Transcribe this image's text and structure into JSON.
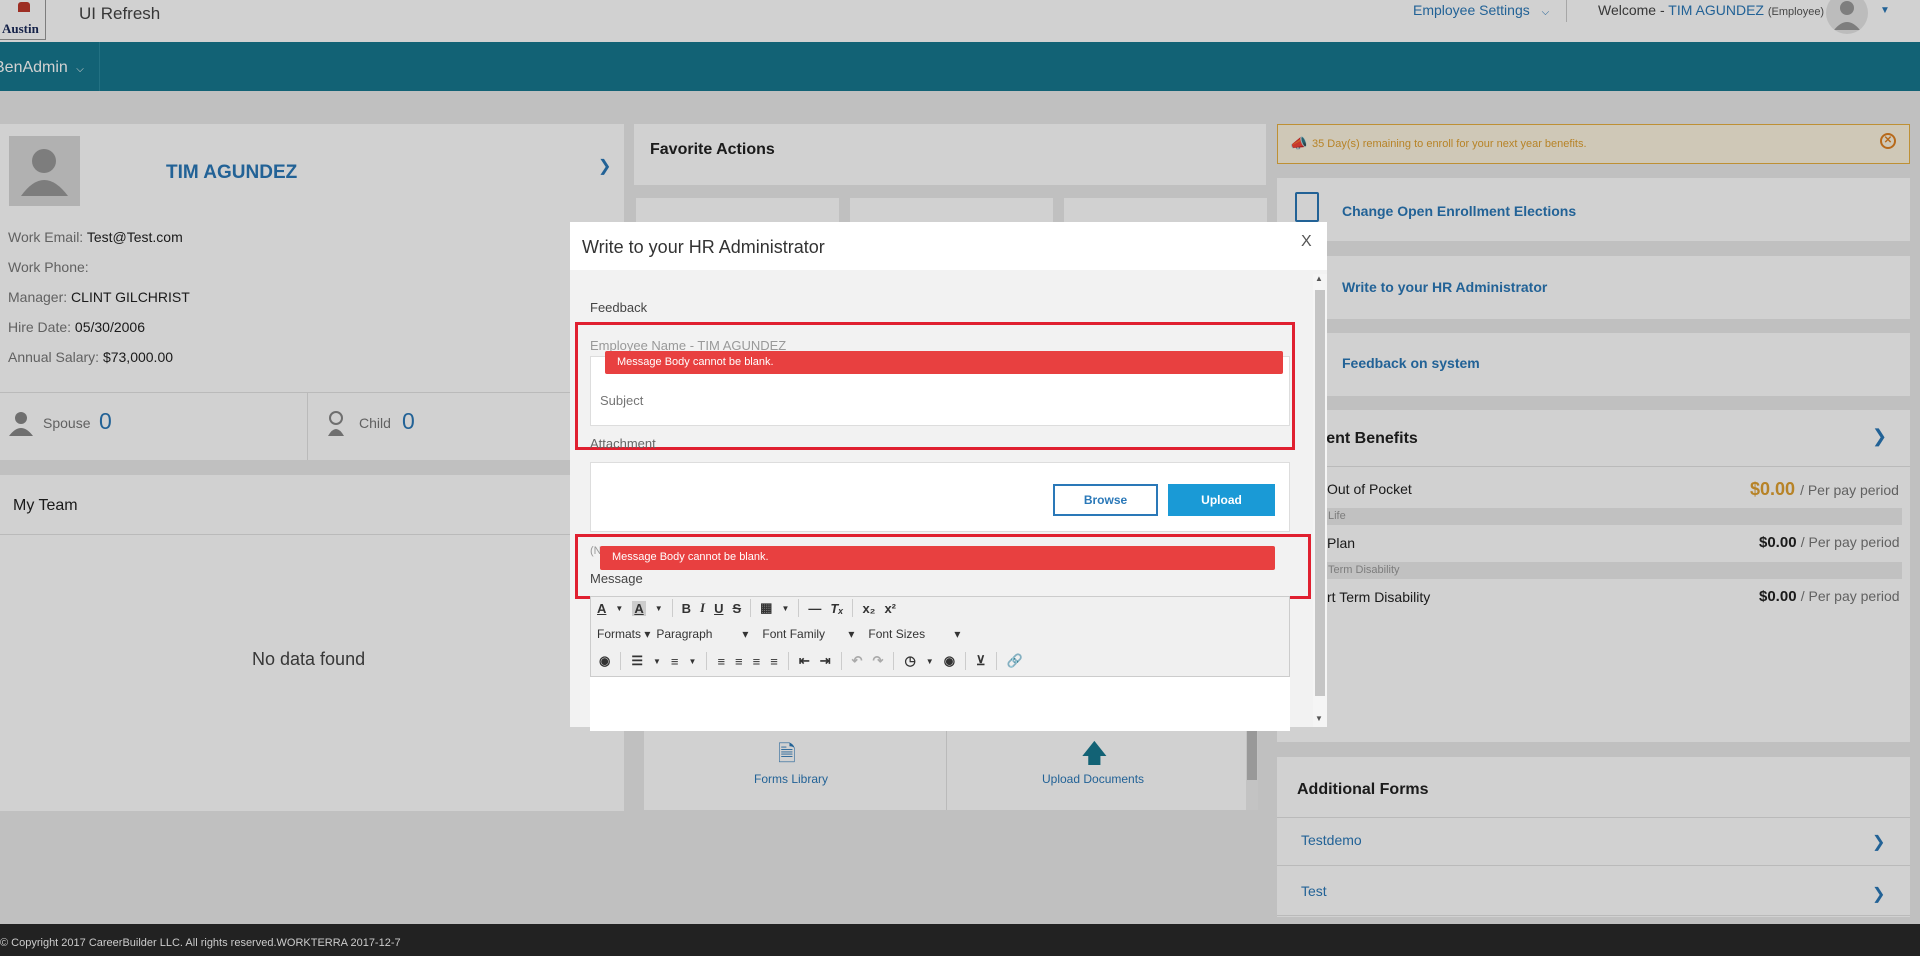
{
  "header": {
    "logo_text": "Austin",
    "app_title": "UI Refresh",
    "employee_settings": "Employee Settings",
    "welcome_prefix": "Welcome -",
    "user_name": "TIM AGUNDEZ",
    "user_role": "(Employee)",
    "nav_item": "BenAdmin"
  },
  "profile": {
    "name": "TIM AGUNDEZ",
    "fields": [
      {
        "label": "Work Email:",
        "value": "Test@Test.com"
      },
      {
        "label": "Work Phone:",
        "value": ""
      },
      {
        "label": "Manager:",
        "value": "CLINT GILCHRIST"
      },
      {
        "label": "Hire Date:",
        "value": "05/30/2006"
      },
      {
        "label": "Annual Salary:",
        "value": "$73,000.00"
      }
    ],
    "spouse_label": "Spouse",
    "spouse_count": "0",
    "child_label": "Child",
    "child_count": "0"
  },
  "my_team": {
    "title": "My Team",
    "empty_text": "No data found"
  },
  "favorites": {
    "title": "Favorite Actions",
    "items": [
      {
        "label": "Forms Library",
        "icon": "document-icon"
      },
      {
        "label": "Upload Documents",
        "icon": "upload-arrow-icon"
      }
    ]
  },
  "alert": {
    "text": "35 Day(s) remaining to enroll for your next year benefits.",
    "color": "#e0a030"
  },
  "quick_links": [
    {
      "label": "Change Open Enrollment Elections"
    },
    {
      "label": "Write to your HR Administrator"
    },
    {
      "label": "Feedback on system"
    }
  ],
  "benefits": {
    "title": "rent Benefits",
    "rows": [
      {
        "label": "Out of Pocket",
        "amount": "$0.00",
        "suffix": "/ Per pay period",
        "band": "Life"
      },
      {
        "label": "Plan",
        "amount": "$0.00",
        "suffix": "/ Per pay period",
        "band": "Term Disability"
      },
      {
        "label": "rt Term Disability",
        "amount": "$0.00",
        "suffix": "/ Per pay period",
        "band": ""
      }
    ]
  },
  "additional_forms": {
    "title": "Additional Forms",
    "items": [
      "Testdemo",
      "Test"
    ]
  },
  "footer": {
    "copyright": "© Copyright 2017 CareerBuilder LLC. All rights reserved.WORKTERRA 2017-12-7"
  },
  "modal": {
    "title": "Write to your HR Administrator",
    "close": "X",
    "feedback_label": "Feedback",
    "employee_name": "Employee Name - TIM AGUNDEZ",
    "subject_placeholder": "Subject",
    "attachment_label": "Attachment",
    "browse": "Browse",
    "upload": "Upload",
    "hint": "(N",
    "message_label": "Message",
    "error_text": "Message Body cannot be blank.",
    "editor": {
      "formats": "Formats",
      "paragraph": "Paragraph",
      "font_family": "Font Family",
      "font_sizes": "Font Sizes"
    }
  },
  "colors": {
    "nav": "#17788f",
    "accent": "#2a78b8",
    "error": "#e84040",
    "primary_button": "#1a9ad6"
  }
}
